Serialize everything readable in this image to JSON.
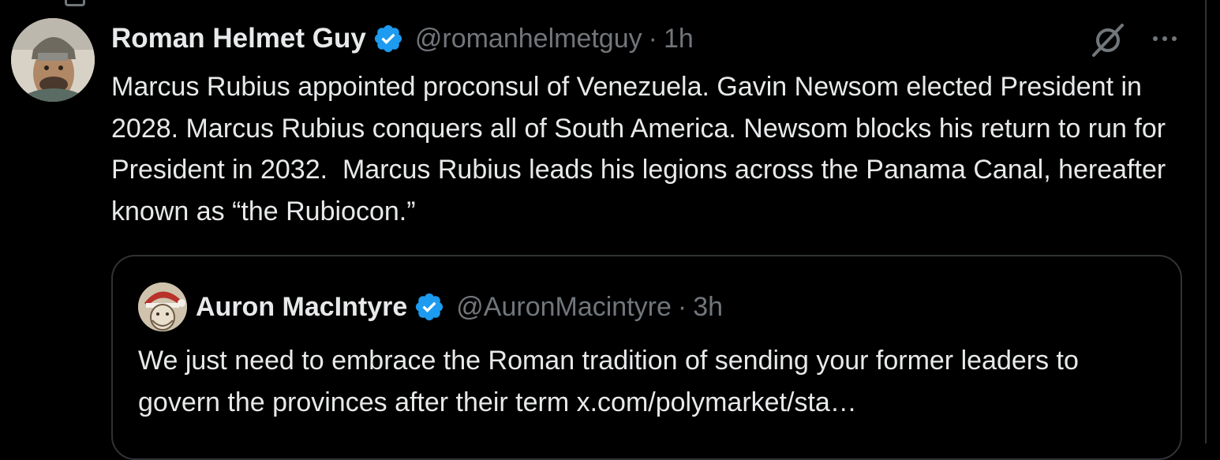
{
  "colors": {
    "background": "#000000",
    "text_primary": "#e7e9ea",
    "text_secondary": "#71767b",
    "verified_blue": "#1d9bf0",
    "border": "#2f3336"
  },
  "icons": {
    "verified": "verified-badge-icon",
    "grok": "grok-icon",
    "more": "more-options-icon"
  },
  "tweet": {
    "author": {
      "display_name": "Roman Helmet Guy",
      "handle": "@romanhelmetguy",
      "separator": "·",
      "time": "1h"
    },
    "text": "Marcus Rubius appointed proconsul of Venezuela. Gavin Newsom elected President in 2028. Marcus Rubius conquers all of South America. Newsom blocks his return to run for President in 2032.  Marcus Rubius leads his legions across the Panama Canal, hereafter known as “the Rubiocon.”",
    "quoted": {
      "author": {
        "display_name": "Auron MacIntyre",
        "handle": "@AuronMacintyre",
        "separator": "·",
        "time": "3h"
      },
      "text": "We just need to embrace the Roman tradition of sending your former leaders to govern the provinces after their term x.com/polymarket/sta…"
    }
  }
}
